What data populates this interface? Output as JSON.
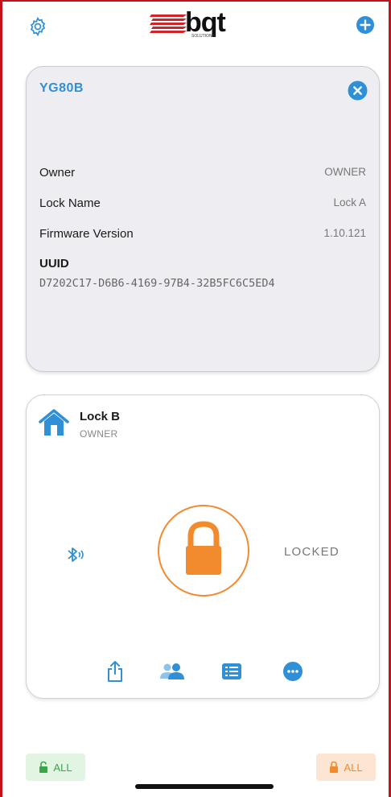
{
  "logo": {
    "text": "bqt",
    "subtext": "SOLUTIONS"
  },
  "icons": {
    "settings": "gear-icon",
    "add": "plus-circle-icon",
    "close": "close-circle-icon"
  },
  "colors": {
    "accent_blue": "#2f8fd7",
    "orange": "#f28a2e",
    "green": "#3aa54b",
    "brand_red": "#c3121b"
  },
  "detail": {
    "id": "YG80B",
    "rows": [
      {
        "label": "Owner",
        "value": "OWNER"
      },
      {
        "label": "Lock Name",
        "value": "Lock A"
      },
      {
        "label": "Firmware Version",
        "value": "1.10.121"
      }
    ],
    "uuid_label": "UUID",
    "uuid": "D7202C17-D6B6-4169-97B4-32B5FC6C5ED4"
  },
  "lock_card": {
    "name": "Lock B",
    "role": "OWNER",
    "status": "LOCKED",
    "actions": [
      "share-icon",
      "users-icon",
      "list-icon",
      "more-icon"
    ]
  },
  "bottom": {
    "left_label": "ALL",
    "right_label": "ALL"
  }
}
